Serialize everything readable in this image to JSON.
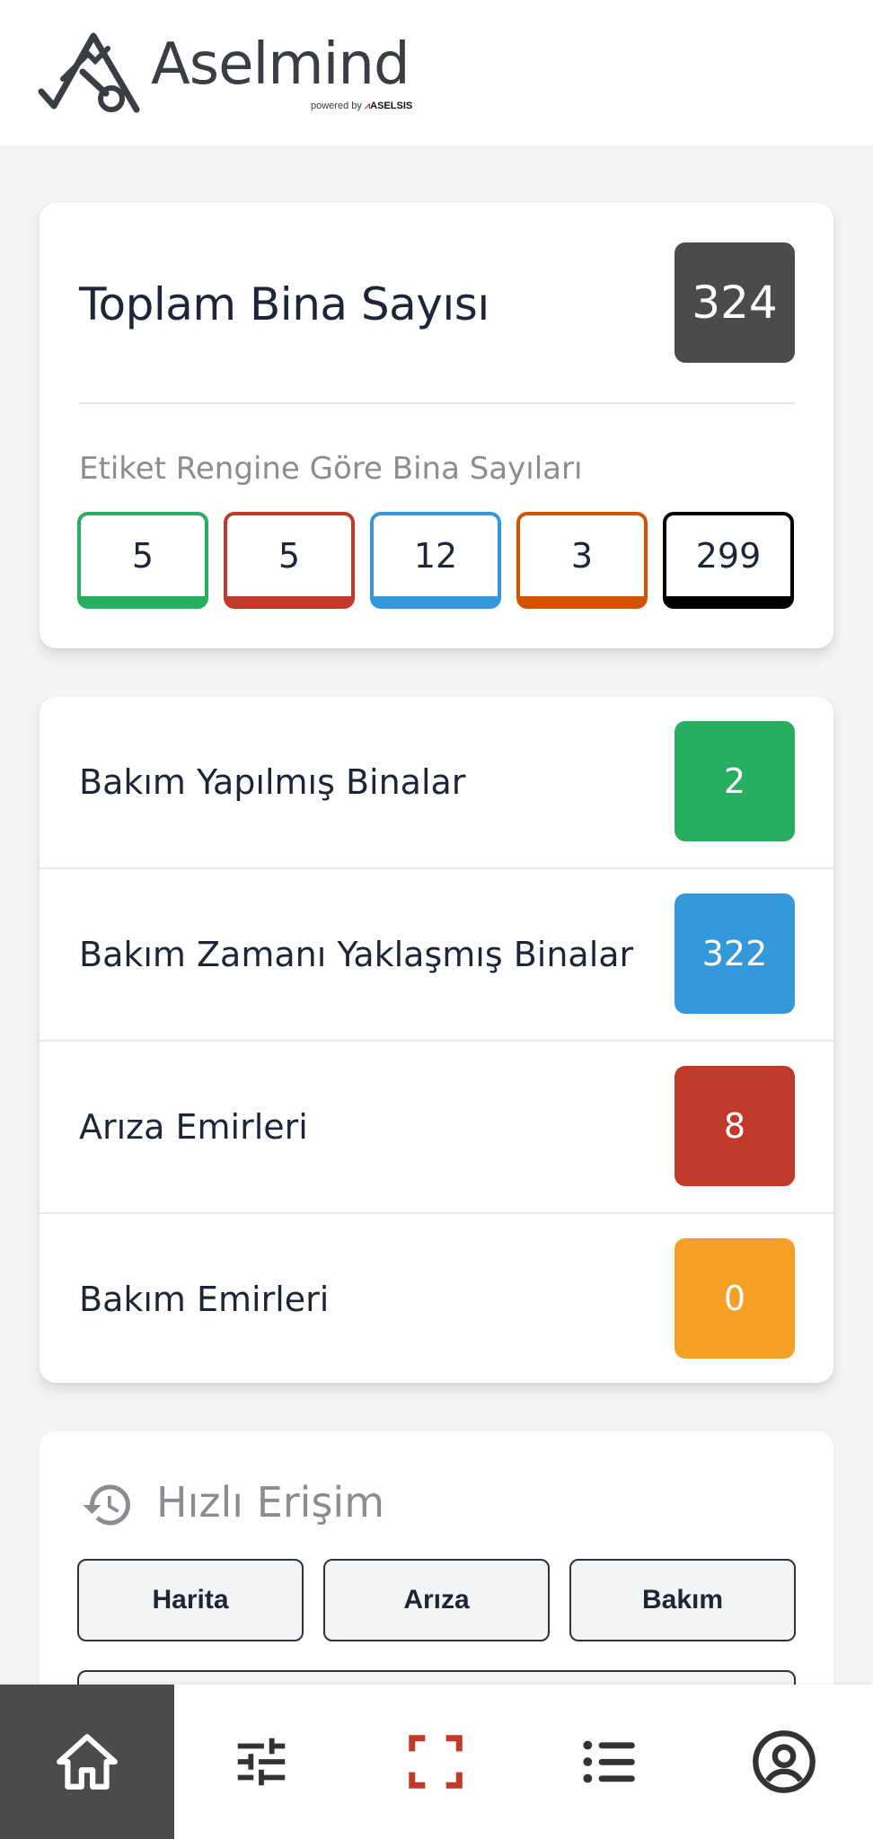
{
  "header": {
    "brand": "Aselmind",
    "powered_by": "powered by",
    "powered_brand": "ASELSIS"
  },
  "summary": {
    "total_label": "Toplam Bina Sayısı",
    "total_value": "324",
    "tags_label": "Etiket Rengine Göre Bina Sayıları",
    "tags": [
      {
        "value": "5",
        "color": "#27ae60"
      },
      {
        "value": "5",
        "color": "#c0392b"
      },
      {
        "value": "12",
        "color": "#3498db"
      },
      {
        "value": "3",
        "color": "#d35400"
      },
      {
        "value": "299",
        "color": "#000000"
      }
    ]
  },
  "stats": [
    {
      "label": "Bakım Yapılmış Binalar",
      "value": "2",
      "color": "#27ae60"
    },
    {
      "label": "Bakım Zamanı Yaklaşmış Binalar",
      "value": "322",
      "color": "#3498db"
    },
    {
      "label": "Arıza Emirleri",
      "value": "8",
      "color": "#c0392b"
    },
    {
      "label": "Bakım Emirleri",
      "value": "0",
      "color": "#f5a025"
    }
  ],
  "quick_access": {
    "title": "Hızlı Erişim",
    "buttons": [
      "Harita",
      "Arıza",
      "Bakım"
    ]
  },
  "nav": {
    "items": [
      "home-icon",
      "sliders-icon",
      "scan-icon",
      "list-icon",
      "account-icon"
    ],
    "active_index": 0,
    "accent": "#c0392b"
  }
}
